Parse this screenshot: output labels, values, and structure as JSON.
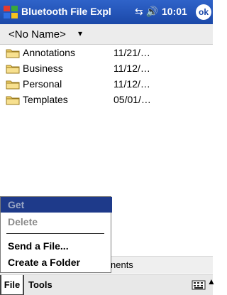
{
  "titlebar": {
    "title": "Bluetooth File Expl",
    "time": "10:01",
    "ok": "ok",
    "icons": [
      "windows-logo-icon",
      "connectivity-icon",
      "speaker-icon"
    ]
  },
  "location": {
    "text": "<No Name>",
    "caret": "▾"
  },
  "files": [
    {
      "name": "Annotations",
      "date": "11/21/…"
    },
    {
      "name": "Business",
      "date": "11/12/…"
    },
    {
      "name": "Personal",
      "date": "11/12/…"
    },
    {
      "name": "Templates",
      "date": "05/01/…"
    }
  ],
  "context_menu": {
    "items": [
      {
        "label": "Get",
        "state": "highlighted-disabled"
      },
      {
        "label": "Delete",
        "state": "disabled"
      },
      {
        "label": "Send a File...",
        "state": "enabled"
      },
      {
        "label": "Create a Folder",
        "state": "enabled"
      }
    ]
  },
  "tab_strip": {
    "partial_label": "nents"
  },
  "menubar": {
    "file": "File",
    "tools": "Tools"
  }
}
